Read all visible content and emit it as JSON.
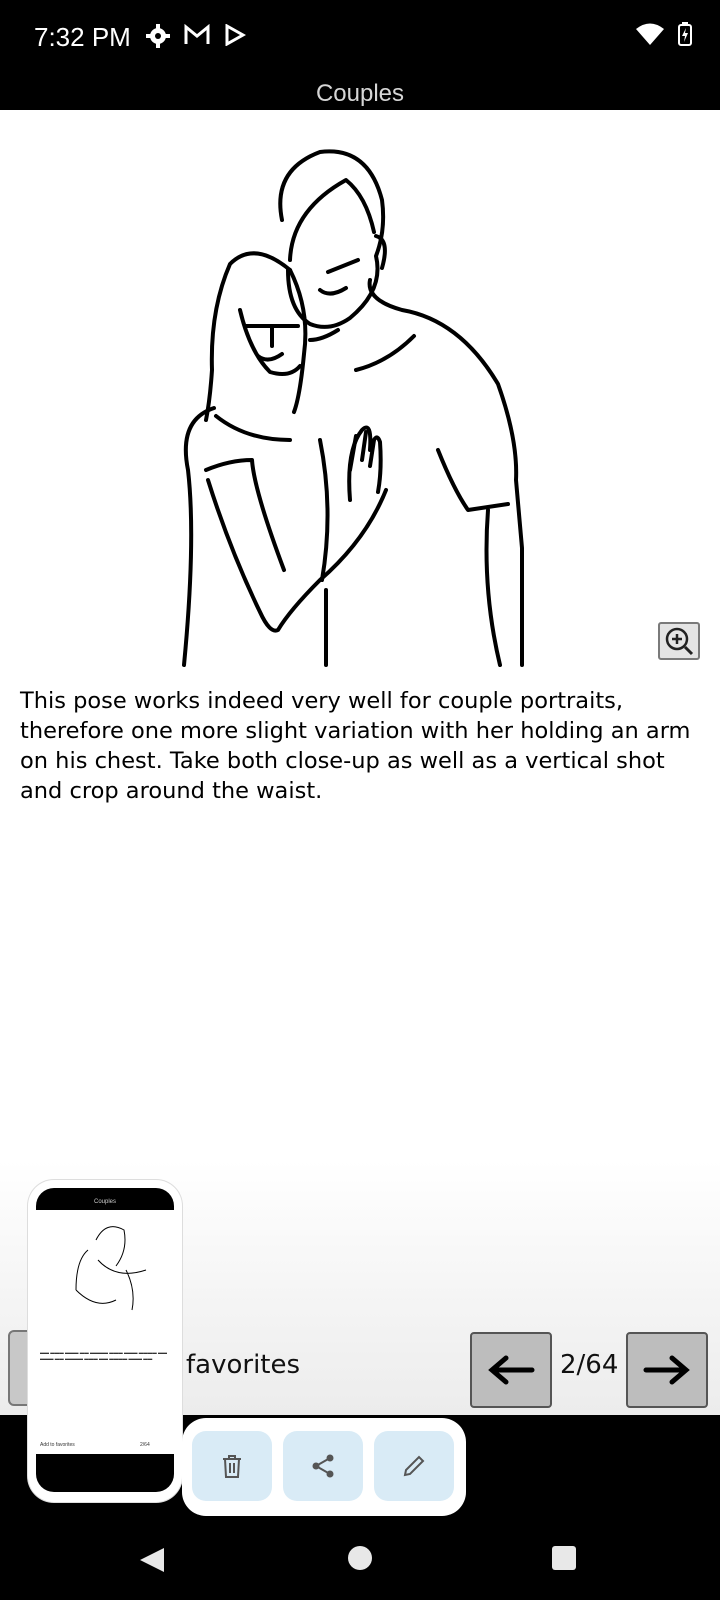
{
  "status_bar": {
    "time": "7:32 PM",
    "icons_left": [
      "settings-icon",
      "gmail-icon",
      "play-store-icon"
    ],
    "icons_right": [
      "wifi-icon",
      "battery-charging-icon"
    ]
  },
  "title_bar": {
    "title": "Couples"
  },
  "pose": {
    "description": "This pose works indeed very well for couple portraits, therefore one more slight variation with her holding an arm on his chest. Take both close-up as well as a vertical shot and crop around the waist."
  },
  "bottom_bar": {
    "favorites_label": "favorites",
    "page_counter": "2/64"
  },
  "screenshot_preview": {
    "title": "Couples",
    "favorites_label": "Add to favorites",
    "page_counter": "2/64"
  },
  "actions": [
    "delete-icon",
    "share-icon",
    "edit-icon"
  ],
  "colors": {
    "action_chip": "#d9ebf6",
    "nav_button": "#bdbdbd"
  }
}
